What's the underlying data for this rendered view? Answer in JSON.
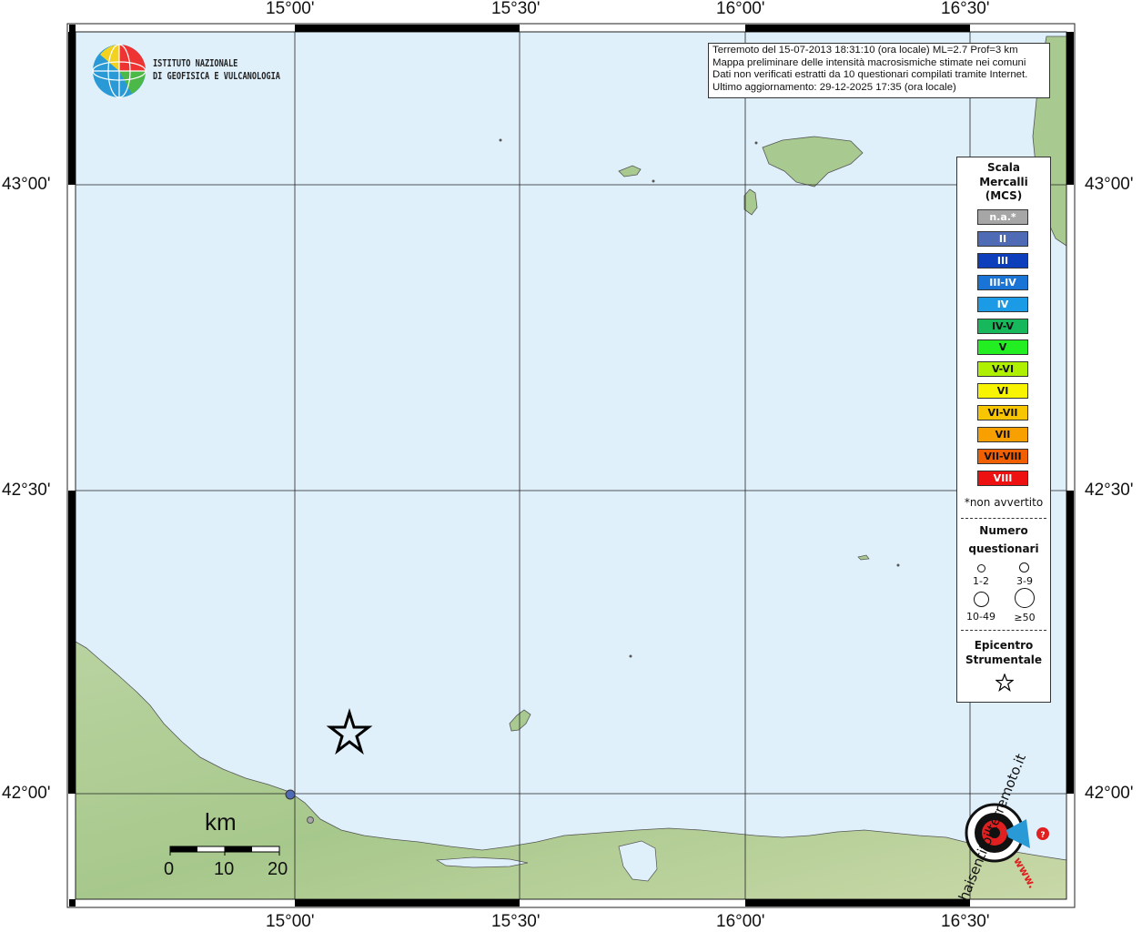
{
  "info": {
    "line1": "Terremoto del 15-07-2013 18:31:10 (ora locale) ML=2.7 Prof=3 km",
    "line2": "Mappa preliminare delle intensità macrosismiche stimate nei comuni",
    "line3": "Dati non verificati estratti da 10 questionari compilati tramite Internet.",
    "line4": "Ultimo aggiornamento: 29-12-2025 17:35 (ora locale)"
  },
  "logo": {
    "line1": "ISTITUTO NAZIONALE",
    "line2": "DI GEOFISICA E VULCANOLOGIA"
  },
  "axes": {
    "lon_top": [
      "15°00'",
      "15°30'",
      "16°00'",
      "16°30'"
    ],
    "lon_bottom": [
      "15°00'",
      "15°30'",
      "16°00'",
      "16°30'"
    ],
    "lat_left": [
      "43°00'",
      "42°30'",
      "42°00'"
    ],
    "lat_right": [
      "43°00'",
      "42°30'",
      "42°00'"
    ]
  },
  "legend": {
    "title": [
      "Scala",
      "Mercalli",
      "(MCS)"
    ],
    "classes": [
      {
        "label": "n.a.*",
        "color": "#a6a6a6",
        "text": "#ffffff"
      },
      {
        "label": "II",
        "color": "#4f6bb5",
        "text": "#ffffff"
      },
      {
        "label": "III",
        "color": "#0d3fbd",
        "text": "#ffffff"
      },
      {
        "label": "III-IV",
        "color": "#1a74d6",
        "text": "#ffffff"
      },
      {
        "label": "IV",
        "color": "#1b9be6",
        "text": "#ffffff"
      },
      {
        "label": "IV-V",
        "color": "#17b85c",
        "text": "#111111"
      },
      {
        "label": "V",
        "color": "#22ee22",
        "text": "#111111"
      },
      {
        "label": "V-VI",
        "color": "#aef000",
        "text": "#111111"
      },
      {
        "label": "VI",
        "color": "#f8f400",
        "text": "#111111"
      },
      {
        "label": "VI-VII",
        "color": "#f8c600",
        "text": "#111111"
      },
      {
        "label": "VII",
        "color": "#f8a000",
        "text": "#111111"
      },
      {
        "label": "VII-VIII",
        "color": "#f06000",
        "text": "#111111"
      },
      {
        "label": "VIII",
        "color": "#ee1111",
        "text": "#ffffff"
      }
    ],
    "note": "*non avvertito",
    "count_title": [
      "Numero",
      "questionari"
    ],
    "counts": [
      "1-2",
      "3-9",
      "10-49",
      "≥50"
    ],
    "epicenter_title": [
      "Epicentro",
      "Strumentale"
    ],
    "epicenter_icon": "star-icon"
  },
  "scale_bar": {
    "unit": "km",
    "labels": [
      "0",
      "10",
      "20"
    ]
  },
  "haisentito": {
    "text": "haisentitoilterremoto.it",
    "www": "www."
  },
  "colors": {
    "sea": "#dff0fb",
    "land": "#a8c98f",
    "grid": "#222222"
  },
  "points": [
    {
      "name": "intensity-ii",
      "color": "#4f6bb5"
    },
    {
      "name": "intensity-na",
      "color": "#a6a6a6"
    }
  ]
}
